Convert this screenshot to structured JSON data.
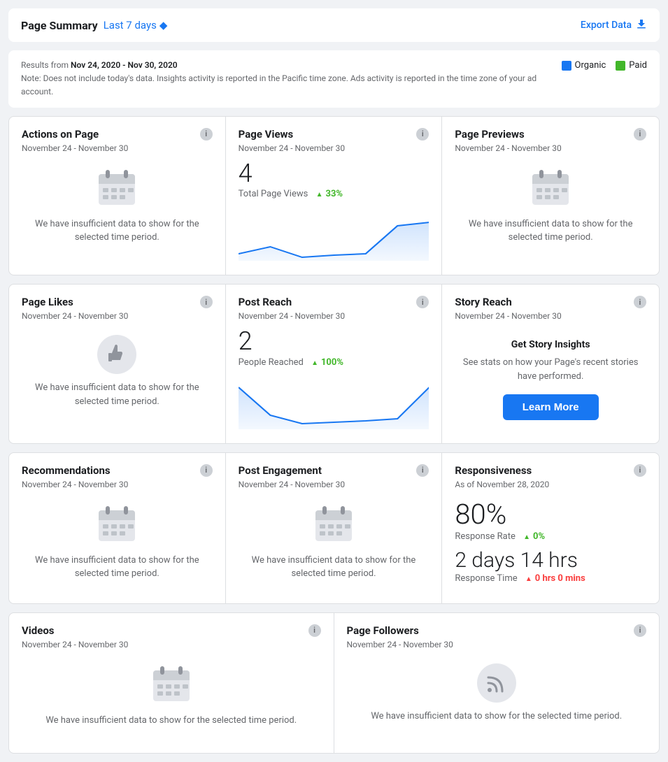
{
  "header": {
    "title": "Page Summary",
    "period": "Last 7 days",
    "period_icon": "◆",
    "export_label": "Export Data"
  },
  "info_banner": {
    "date_range": "Nov 24, 2020 - Nov 30, 2020",
    "note": "Note: Does not include today's data. Insights activity is reported in the Pacific time zone. Ads activity is reported in the time zone of your ad account."
  },
  "legend": {
    "organic_label": "Organic",
    "organic_color": "#1877f2",
    "paid_label": "Paid",
    "paid_color": "#42b72a"
  },
  "cells": {
    "actions_on_page": {
      "title": "Actions on Page",
      "date": "November 24 - November 30",
      "insufficient": true,
      "insufficient_text": "We have insufficient data to show for the selected time period."
    },
    "page_views": {
      "title": "Page Views",
      "date": "November 24 - November 30",
      "value": "4",
      "label": "Total Page Views",
      "trend_pct": "33%",
      "trend_dir": "up"
    },
    "page_previews": {
      "title": "Page Previews",
      "date": "November 24 - November 30",
      "insufficient": true,
      "insufficient_text": "We have insufficient data to show for the selected time period."
    },
    "page_likes": {
      "title": "Page Likes",
      "date": "November 24 - November 30",
      "insufficient": true,
      "insufficient_text": "We have insufficient data to show for the selected time period."
    },
    "post_reach": {
      "title": "Post Reach",
      "date": "November 24 - November 30",
      "value": "2",
      "label": "People Reached",
      "trend_pct": "100%",
      "trend_dir": "up"
    },
    "story_reach": {
      "title": "Story Reach",
      "date": "November 24 - November 30",
      "promo_title": "Get Story Insights",
      "promo_desc": "See stats on how your Page's recent stories have performed.",
      "learn_more_label": "Learn More"
    },
    "recommendations": {
      "title": "Recommendations",
      "date": "November 24 - November 30",
      "insufficient": true,
      "insufficient_text": "We have insufficient data to show for the selected time period."
    },
    "post_engagement": {
      "title": "Post Engagement",
      "date": "November 24 - November 30",
      "insufficient": true,
      "insufficient_text": "We have insufficient data to show for the selected time period."
    },
    "responsiveness": {
      "title": "Responsiveness",
      "date": "As of November 28, 2020",
      "response_rate": "80%",
      "response_rate_label": "Response Rate",
      "response_rate_trend": "0%",
      "response_rate_trend_dir": "up_green",
      "response_time": "2 days 14 hrs",
      "response_time_label": "Response Time",
      "response_time_trend": "0 hrs 0 mins",
      "response_time_trend_dir": "up_red"
    },
    "videos": {
      "title": "Videos",
      "date": "November 24 - November 30",
      "insufficient": true,
      "insufficient_text": "We have insufficient data to show for the selected time period."
    },
    "page_followers": {
      "title": "Page Followers",
      "date": "November 24 - November 30",
      "insufficient": true,
      "insufficient_text": "We have insufficient data to show for the selected time period."
    }
  }
}
